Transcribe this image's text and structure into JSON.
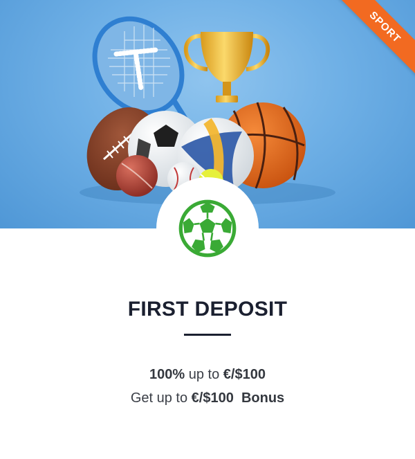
{
  "ribbon": {
    "label": "SPORT"
  },
  "hero": {
    "image": "sports-balls-and-trophy-illustration"
  },
  "badge": {
    "icon": "soccer-ball-icon",
    "color": "#3aaa35"
  },
  "offer": {
    "title": "FIRST DEPOSIT",
    "line1": {
      "strong_a": "100%",
      "text_a": " up to ",
      "strong_b": "€/$100"
    },
    "line2": {
      "text_a": "Get up to ",
      "strong_a": "€/$100",
      "text_b": "  ",
      "strong_b": "Bonus"
    }
  },
  "colors": {
    "ribbon": "#f26a21",
    "hero_bg": "#6fb0e6",
    "accent_green": "#3aaa35",
    "title": "#1b2030"
  }
}
